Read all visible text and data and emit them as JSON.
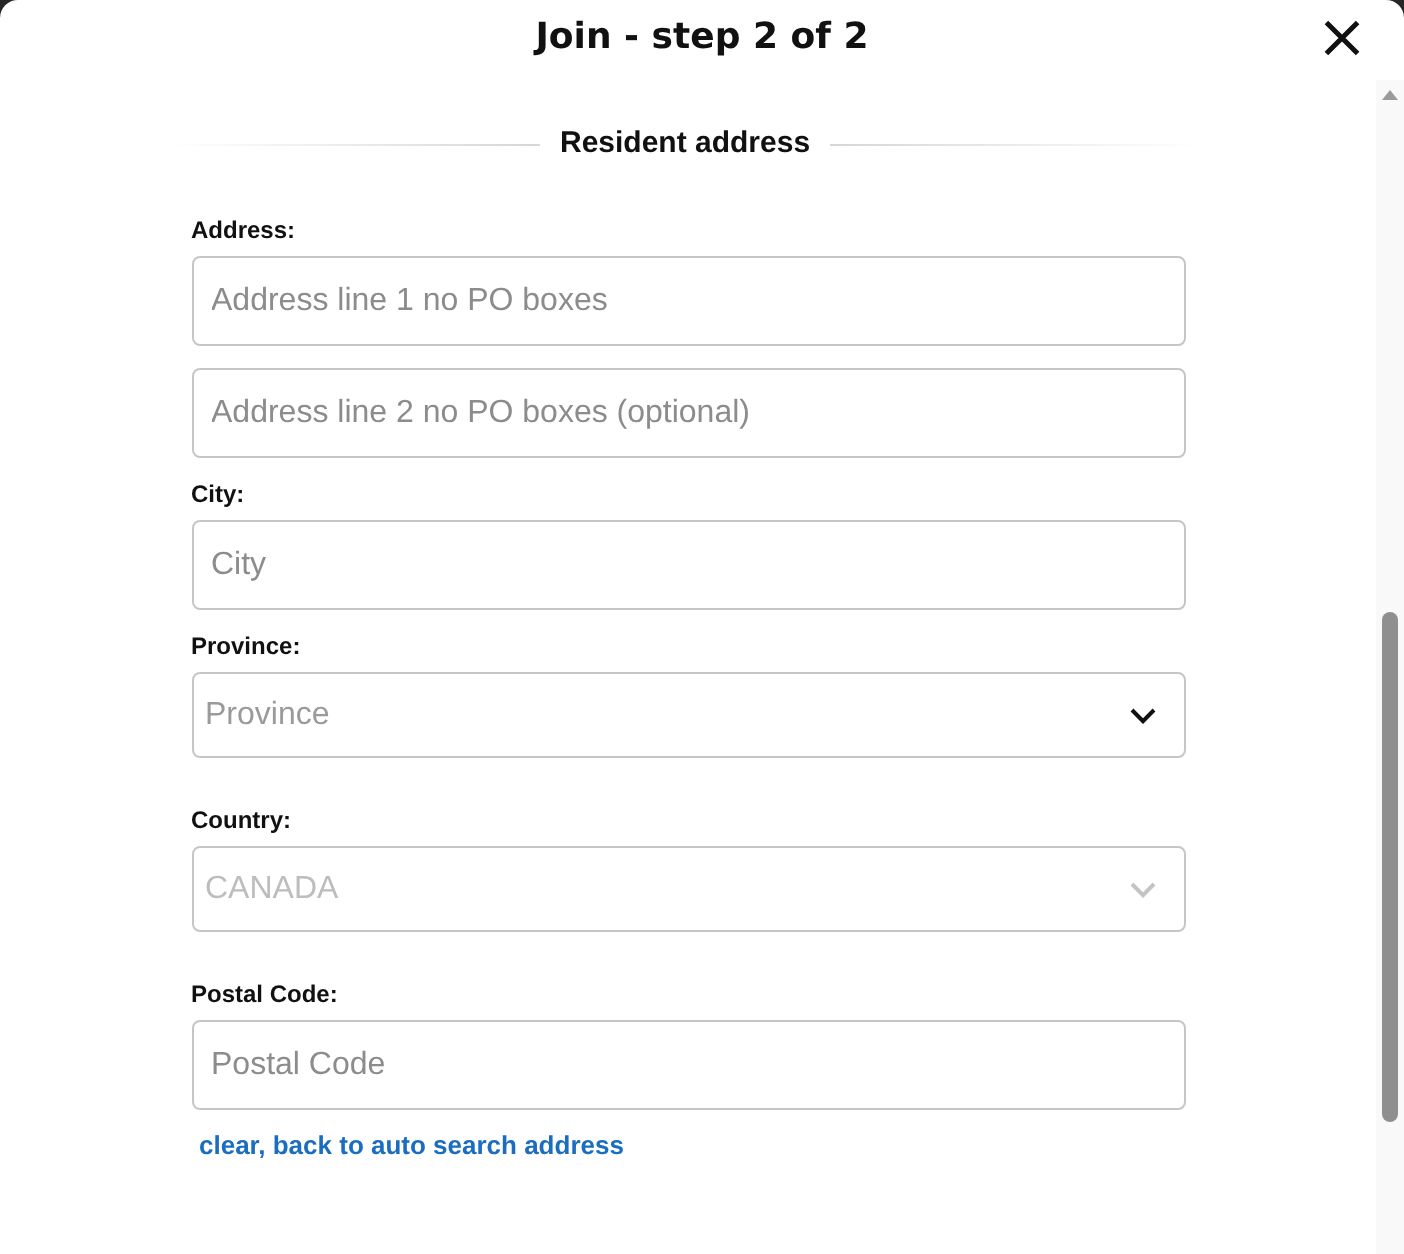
{
  "dialog": {
    "title": "Join - step 2 of 2"
  },
  "section": {
    "title": "Resident address"
  },
  "fields": [
    {
      "kind": "text",
      "label": "Address:",
      "placeholder": "Address line 1 no PO boxes",
      "disabled": false
    },
    {
      "kind": "text",
      "placeholder": "Address line 2 no PO boxes (optional)",
      "disabled": false
    },
    {
      "kind": "text",
      "label": "City:",
      "placeholder": "City",
      "disabled": false
    },
    {
      "kind": "select",
      "label": "Province:",
      "placeholder": "Province",
      "disabled": false
    },
    {
      "kind": "select",
      "label": "Country:",
      "value": "CANADA",
      "disabled": true
    },
    {
      "kind": "text",
      "label": "Postal Code:",
      "placeholder": "Postal Code",
      "disabled": false
    }
  ],
  "link": {
    "label": "clear, back to auto search address"
  }
}
